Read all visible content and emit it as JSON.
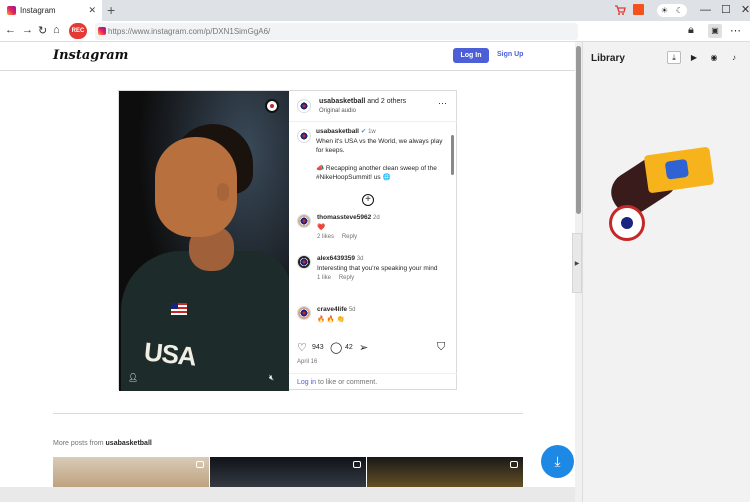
{
  "browser": {
    "tab_title": "Instagram",
    "url": "https://www.instagram.com/p/DXN1SimGgA6/",
    "rec_label": "REC"
  },
  "instagram": {
    "logo": "Instagram",
    "login_label": "Log In",
    "signup_label": "Sign Up"
  },
  "post": {
    "author": "usabasketball",
    "coauthors": "and 2 others",
    "audio": "Original audio",
    "caption_author": "usabasketball",
    "caption_time": "1w",
    "caption_text": "When it's USA vs the World, we always play for keeps.",
    "caption_text2": "Recapping another clean sweep of the #NikeHoopSummit!",
    "caption_tail": "us",
    "comments": [
      {
        "user": "thomassteve5962",
        "time": "2d",
        "text": "❤️",
        "likes": "2 likes",
        "reply": "Reply"
      },
      {
        "user": "alex6439359",
        "time": "3d",
        "text": "Interesting that you're speaking your mind",
        "likes": "1 like",
        "reply": "Reply"
      },
      {
        "user": "crave4life",
        "time": "5d",
        "text": "🔥 🔥 👏"
      }
    ],
    "likes": "943",
    "comment_count": "42",
    "date": "April 16",
    "login_prompt_link": "Log in",
    "login_prompt_rest": " to like or comment."
  },
  "more_posts": {
    "prefix": "More posts from",
    "user": "usabasketball"
  },
  "library": {
    "title": "Library"
  },
  "colors": {
    "accent": "#4c5fd7",
    "fab": "#1e88e5"
  }
}
